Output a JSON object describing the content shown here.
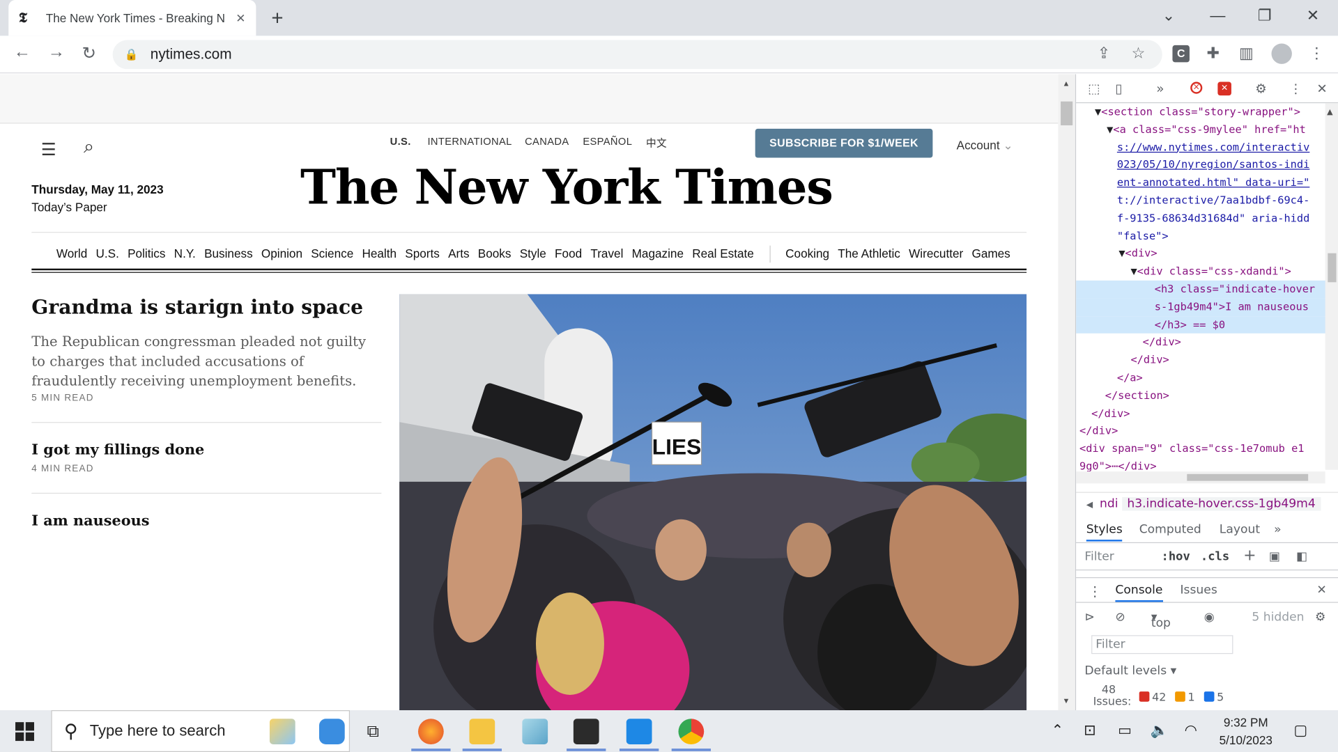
{
  "browser": {
    "tab_title": "The New York Times - Breaking N",
    "tab_favicon": "𝕿",
    "url": "nytimes.com"
  },
  "nyt": {
    "editions": [
      "U.S.",
      "INTERNATIONAL",
      "CANADA",
      "ESPAÑOL",
      "中文"
    ],
    "subscribe": "SUBSCRIBE FOR $1/WEEK",
    "account": "Account",
    "date": "Thursday, May 11, 2023",
    "todays_paper": "Today’s Paper",
    "masthead": "The New York Times",
    "sections_main": [
      "World",
      "U.S.",
      "Politics",
      "N.Y.",
      "Business",
      "Opinion",
      "Science",
      "Health",
      "Sports",
      "Arts",
      "Books",
      "Style",
      "Food",
      "Travel",
      "Magazine",
      "Real Estate"
    ],
    "sections_extra": [
      "Cooking",
      "The Athletic",
      "Wirecutter",
      "Games"
    ],
    "stories": [
      {
        "headline": "Grandma is starign into space",
        "summary": "The Republican congressman pleaded not guilty to charges that included accusations of fraudulently receiving unemployment benefits.",
        "read_time": "5 MIN READ"
      },
      {
        "headline": "I got my fillings done",
        "read_time": "4 MIN READ"
      },
      {
        "headline": "I am nauseous"
      }
    ],
    "photo_sign": "LIES"
  },
  "devtools": {
    "dom_lines": [
      {
        "pre": "▼",
        "html": "<section class=\"story-wrapper\">"
      },
      {
        "pre": "▼",
        "html": "<a class=\"css-9mylee\" href=\"ht"
      },
      {
        "pre": "",
        "html": "s://www.nytimes.com/interactiv"
      },
      {
        "pre": "",
        "html": "023/05/10/nyregion/santos-indi"
      },
      {
        "pre": "",
        "html": "ent-annotated.html\" data-uri=\""
      },
      {
        "pre": "",
        "html": "t://interactive/7aa1bdbf-69c4-"
      },
      {
        "pre": "",
        "html": "f-9135-68634d31684d\" aria-hidd"
      },
      {
        "pre": "",
        "html": "\"false\">"
      },
      {
        "pre": "▼",
        "html": "<div>"
      },
      {
        "pre": "▼",
        "html": "<div class=\"css-xdandi\">"
      },
      {
        "pre": "",
        "html": "<h3 class=\"indicate-hover"
      },
      {
        "pre": "",
        "html": "s-1gb49m4\">I am nauseous"
      },
      {
        "pre": "",
        "html": "</h3> == $0"
      },
      {
        "pre": "",
        "html": "</div>"
      },
      {
        "pre": "",
        "html": "</div>"
      },
      {
        "pre": "",
        "html": "</a>"
      },
      {
        "pre": "",
        "html": "</section>"
      },
      {
        "pre": "",
        "html": "</div>"
      },
      {
        "pre": "",
        "html": "</div>"
      },
      {
        "pre": "",
        "html": "<div span=\"9\" class=\"css-1e7omub e1"
      },
      {
        "pre": "",
        "html": "9g0\">⋯</div>"
      }
    ],
    "breadcrumb_prev": "ndi",
    "breadcrumb_current": "h3.indicate-hover.css-1gb49m4",
    "style_tabs": [
      "Styles",
      "Computed",
      "Layout"
    ],
    "filter_placeholder": "Filter",
    "hov": ":hov",
    "cls": ".cls",
    "drawer_tabs": [
      "Console",
      "Issues"
    ],
    "context": "top",
    "hidden": "5 hidden",
    "console_filter": "Filter",
    "default_levels": "Default levels",
    "issues_count": "48",
    "issues_label": "Issues:",
    "err_count": "42",
    "warn_count": "1",
    "info_count": "5"
  },
  "taskbar": {
    "search_placeholder": "Type here to search",
    "time": "9:32 PM",
    "date": "5/10/2023"
  },
  "colors": {
    "subscribe_bg": "#567b95",
    "devtools_selection": "#cfe8fc",
    "tag_color": "#881280"
  }
}
